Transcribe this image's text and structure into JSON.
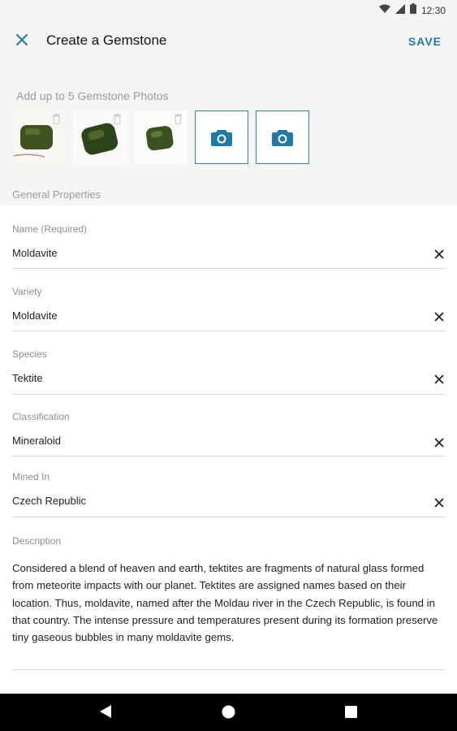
{
  "status_bar": {
    "time": "12:30"
  },
  "app_bar": {
    "title": "Create a Gemstone",
    "save_label": "SAVE"
  },
  "photos": {
    "label": "Add up to 5 Gemstone Photos",
    "uploaded_count": 3,
    "empty_slots": 2,
    "general_properties_label": "General Properties"
  },
  "fields": {
    "name": {
      "label": "Name (Required)",
      "value": "Moldavite"
    },
    "variety": {
      "label": "Variety",
      "value": "Moldavite"
    },
    "species": {
      "label": "Species",
      "value": "Tektite"
    },
    "classification": {
      "label": "Classification",
      "value": "Mineraloid"
    },
    "mined_in": {
      "label": "Mined In",
      "value": "Czech Republic"
    },
    "description": {
      "label": "Description",
      "value": "Considered a blend of heaven and earth, tektites are fragments of natural glass formed from meteorite impacts with our planet. Tektites are assigned names based on their location. Thus, moldavite, named after the Moldau river in the Czech Republic, is found in that country. The intense pressure and temperatures present during its formation preserve tiny gaseous bubbles in many moldavite gems."
    }
  },
  "colors": {
    "accent": "#1f7aa6",
    "header_bg": "#f5f5f4",
    "gem": "#3f5322"
  },
  "icons": [
    "wifi-icon",
    "signal-icon",
    "battery-icon",
    "close-icon",
    "trash-icon",
    "camera-icon",
    "back-icon",
    "home-icon",
    "recents-icon"
  ]
}
